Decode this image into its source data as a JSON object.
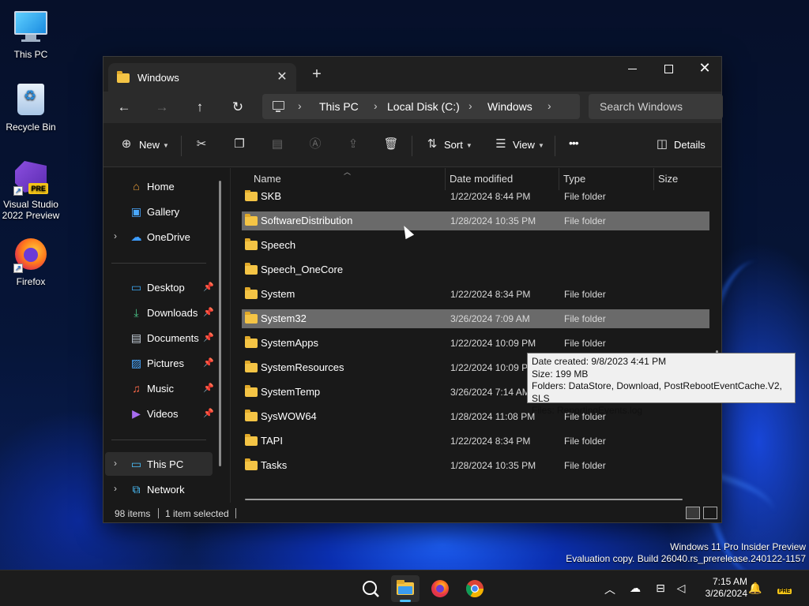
{
  "desktop": {
    "icons": [
      {
        "label": "This PC"
      },
      {
        "label": "Recycle Bin"
      },
      {
        "label": "Visual Studio 2022 Preview",
        "badge": "PRE"
      },
      {
        "label": "Firefox"
      }
    ]
  },
  "window": {
    "tab_title": "Windows",
    "new_tab": "+",
    "close_tab": "✕",
    "controls": {
      "minimize": "minimize-icon",
      "maximize": "maximize-icon",
      "close": "✕"
    },
    "nav": {
      "back": "←",
      "forward": "→",
      "up": "↑",
      "refresh": "↻"
    },
    "breadcrumbs": [
      "This PC",
      "Local Disk (C:)",
      "Windows"
    ],
    "search_placeholder": "Search Windows",
    "toolbar": {
      "new_label": "New",
      "sort_label": "Sort",
      "view_label": "View",
      "more": "•••",
      "details_label": "Details"
    },
    "sidebar": {
      "items": [
        {
          "label": "Home",
          "icon": "home-icon"
        },
        {
          "label": "Gallery",
          "icon": "gallery-icon"
        },
        {
          "label": "OneDrive",
          "icon": "cloud-icon"
        },
        {
          "label": "Desktop",
          "icon": "desktop-icon"
        },
        {
          "label": "Downloads",
          "icon": "download-icon"
        },
        {
          "label": "Documents",
          "icon": "documents-icon"
        },
        {
          "label": "Pictures",
          "icon": "pictures-icon"
        },
        {
          "label": "Music",
          "icon": "music-icon"
        },
        {
          "label": "Videos",
          "icon": "videos-icon"
        },
        {
          "label": "This PC",
          "icon": "pc-icon"
        },
        {
          "label": "Network",
          "icon": "network-icon"
        }
      ]
    },
    "columns": [
      "Name",
      "Date modified",
      "Type",
      "Size"
    ],
    "rows": [
      {
        "name": "SKB",
        "date": "1/22/2024 8:44 PM",
        "type": "File folder"
      },
      {
        "name": "SoftwareDistribution",
        "date": "1/28/2024 10:35 PM",
        "type": "File folder"
      },
      {
        "name": "Speech",
        "date": "",
        "type": ""
      },
      {
        "name": "Speech_OneCore",
        "date": "",
        "type": ""
      },
      {
        "name": "System",
        "date": "1/22/2024 8:34 PM",
        "type": "File folder"
      },
      {
        "name": "System32",
        "date": "3/26/2024 7:09 AM",
        "type": "File folder"
      },
      {
        "name": "SystemApps",
        "date": "1/22/2024 10:09 PM",
        "type": "File folder"
      },
      {
        "name": "SystemResources",
        "date": "1/22/2024 10:09 PM",
        "type": "File folder"
      },
      {
        "name": "SystemTemp",
        "date": "3/26/2024 7:14 AM",
        "type": "File folder"
      },
      {
        "name": "SysWOW64",
        "date": "1/28/2024 11:08 PM",
        "type": "File folder"
      },
      {
        "name": "TAPI",
        "date": "1/22/2024 8:34 PM",
        "type": "File folder"
      },
      {
        "name": "Tasks",
        "date": "1/28/2024 10:35 PM",
        "type": "File folder"
      }
    ],
    "tooltip": {
      "line1": "Date created: 9/8/2023 4:41 PM",
      "line2": "Size: 199 MB",
      "line3": "Folders: DataStore, Download, PostRebootEventCache.V2, SLS",
      "line4": "Files: ReportingEvents.log"
    },
    "status": {
      "items_count": "98 items",
      "selected": "1 item selected"
    }
  },
  "watermark": {
    "line1": "Windows 11 Pro Insider Preview",
    "line2": "Evaluation copy. Build 26040.rs_prerelease.240122-1157"
  },
  "taskbar": {
    "clock_time": "7:15 AM",
    "clock_date": "3/26/2024",
    "badge": "PRE"
  }
}
